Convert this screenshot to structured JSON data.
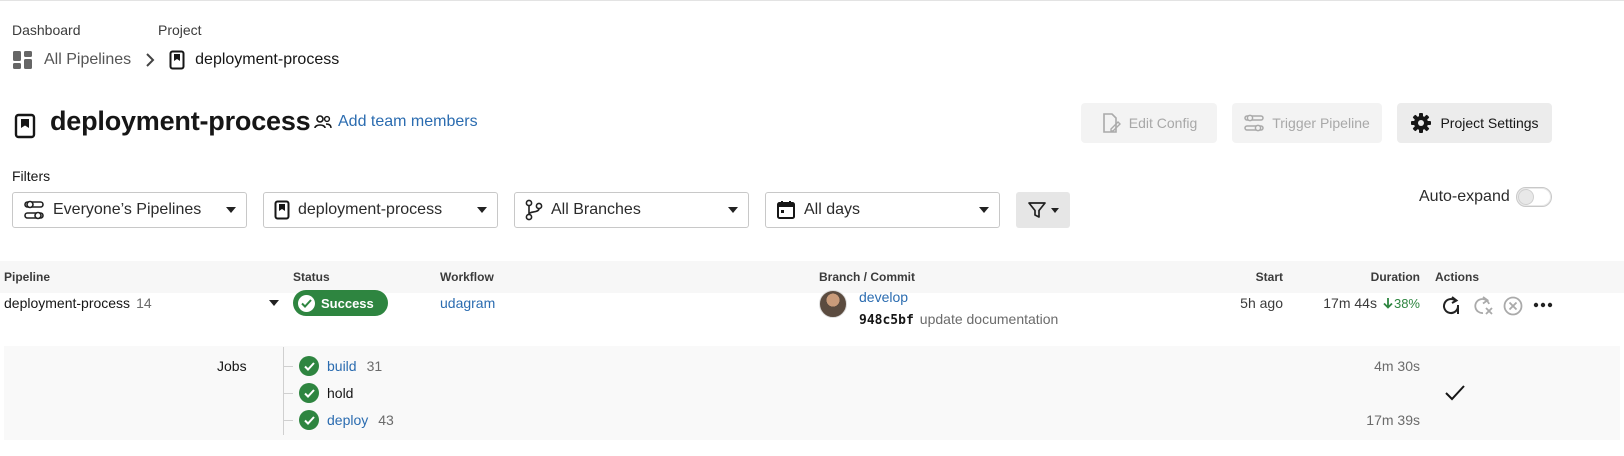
{
  "breadcrumb": {
    "dashboard_label": "Dashboard",
    "project_label": "Project",
    "all_pipelines": "All Pipelines",
    "current_project": "deployment-process"
  },
  "header": {
    "title": "deployment-process",
    "add_team_members": "Add team members",
    "edit_config": "Edit Config",
    "trigger_pipeline": "Trigger Pipeline",
    "project_settings": "Project Settings"
  },
  "filters": {
    "label": "Filters",
    "pipelines_select": "Everyone’s Pipelines",
    "project_select": "deployment-process",
    "branch_select": "All Branches",
    "date_select": "All days",
    "auto_expand_label": "Auto-expand",
    "auto_expand_on": false
  },
  "table": {
    "columns": {
      "pipeline": "Pipeline",
      "status": "Status",
      "workflow": "Workflow",
      "branch_commit": "Branch / Commit",
      "start": "Start",
      "duration": "Duration",
      "actions": "Actions"
    },
    "row": {
      "pipeline_name": "deployment-process",
      "pipeline_number": "14",
      "status": "Success",
      "workflow": "udagram",
      "branch": "develop",
      "commit_hash": "948c5bf",
      "commit_message": "update documentation",
      "start": "5h ago",
      "duration": "17m 44s",
      "duration_change": "38%"
    },
    "jobs_label": "Jobs",
    "jobs": [
      {
        "name": "build",
        "number": "31",
        "duration": "4m 30s"
      },
      {
        "name": "hold",
        "number": "",
        "duration": ""
      },
      {
        "name": "deploy",
        "number": "43",
        "duration": "17m 39s"
      }
    ]
  },
  "colors": {
    "success_green": "#2e8540",
    "link_blue": "#2b6cb0"
  },
  "icons": {
    "dashboard": "dashboard-grid-icon",
    "project": "bookmark-icon",
    "team": "people-icon",
    "edit_config": "file-edit-icon",
    "trigger": "sliders-icon",
    "settings": "gear-icon",
    "branch": "git-branch-icon",
    "calendar": "calendar-icon",
    "filter": "funnel-icon",
    "rerun": "rerun-icon",
    "rerun_failed": "rerun-failed-icon",
    "cancel": "cancel-icon",
    "more": "more-icon",
    "approved": "checkmark-icon"
  }
}
